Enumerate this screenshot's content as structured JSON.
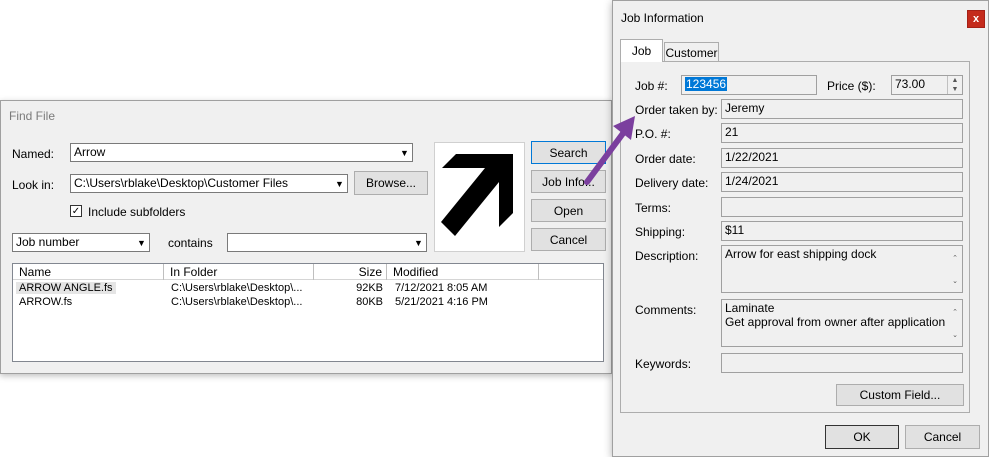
{
  "find_file": {
    "title": "Find File",
    "named_label": "Named:",
    "named_value": "Arrow",
    "look_in_label": "Look in:",
    "look_in_value": "C:\\Users\\rblake\\Desktop\\Customer Files",
    "browse_label": "Browse...",
    "include_subfolders_label": "Include subfolders",
    "include_subfolders_checked": true,
    "criteria_field": "Job number",
    "criteria_op": "contains",
    "criteria_value": "",
    "buttons": {
      "search": "Search",
      "job_info": "Job Info...",
      "open": "Open",
      "cancel": "Cancel"
    },
    "columns": [
      "Name",
      "In Folder",
      "Size",
      "Modified"
    ],
    "rows": [
      {
        "name": "ARROW ANGLE.fs",
        "folder": "C:\\Users\\rblake\\Desktop\\...",
        "size": "92KB",
        "modified": "7/12/2021 8:05 AM"
      },
      {
        "name": "ARROW.fs",
        "folder": "C:\\Users\\rblake\\Desktop\\...",
        "size": "80KB",
        "modified": "5/21/2021 4:16 PM"
      }
    ]
  },
  "job_info": {
    "title": "Job Information",
    "close_label": "x",
    "tabs": [
      "Job",
      "Customer"
    ],
    "job_number_label": "Job #:",
    "job_number_value": "123456",
    "price_label": "Price ($):",
    "price_value": "73.00",
    "order_taken_by_label": "Order taken by:",
    "order_taken_by_value": "Jeremy",
    "po_label": "P.O. #:",
    "po_value": "21",
    "order_date_label": "Order date:",
    "order_date_value": "1/22/2021",
    "delivery_date_label": "Delivery date:",
    "delivery_date_value": "1/24/2021",
    "terms_label": "Terms:",
    "terms_value": "",
    "shipping_label": "Shipping:",
    "shipping_value": "$11",
    "description_label": "Description:",
    "description_value": "Arrow for east shipping dock",
    "comments_label": "Comments:",
    "comments_line1": "Laminate",
    "comments_line2": "Get approval from owner after application",
    "keywords_label": "Keywords:",
    "keywords_value": "",
    "custom_field_label": "Custom Field...",
    "ok_label": "OK",
    "cancel_label": "Cancel"
  },
  "colors": {
    "annotation_arrow": "#7b3f9e",
    "selection": "#0078d7",
    "close_button": "#c42b1c"
  }
}
